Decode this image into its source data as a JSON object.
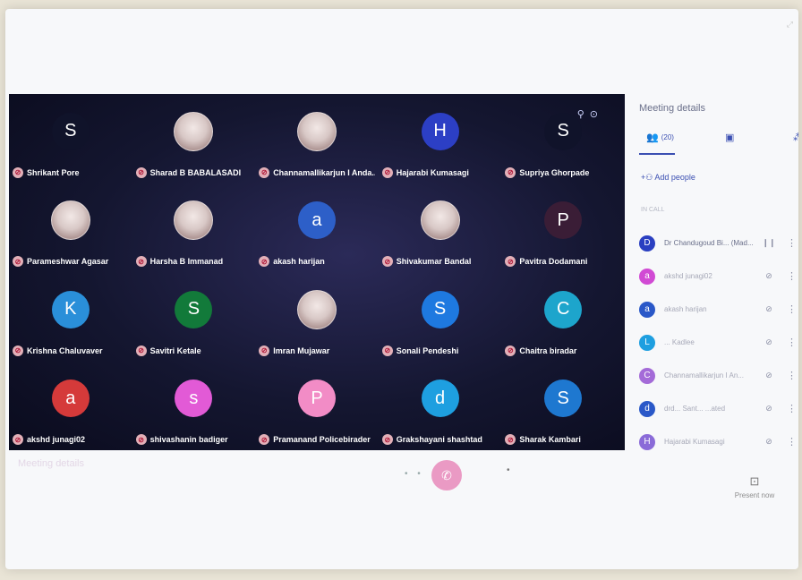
{
  "colors": {
    "grid_bg": "#141630",
    "accent": "#3b4fb2",
    "end_call": "#ea9ac4",
    "mic_muted": "#b01737"
  },
  "tiles": [
    {
      "name": "Shrikant Pore",
      "initial": "S",
      "color": "#10132a",
      "photo": false,
      "tools": false
    },
    {
      "name": "Sharad B BABALASADI",
      "initial": "",
      "color": "",
      "photo": true,
      "tools": false
    },
    {
      "name": "Channamallikarjun I Anda...",
      "initial": "",
      "color": "",
      "photo": true,
      "tools": false
    },
    {
      "name": "Hajarabi Kumasagi",
      "initial": "H",
      "color": "#2c3fc5",
      "photo": false,
      "tools": false
    },
    {
      "name": "Supriya Ghorpade",
      "initial": "S",
      "color": "#10132a",
      "photo": false,
      "tools": true
    },
    {
      "name": "Parameshwar Agasar",
      "initial": "",
      "color": "",
      "photo": true,
      "tools": false
    },
    {
      "name": "Harsha B Immanad",
      "initial": "",
      "color": "",
      "photo": true,
      "tools": false
    },
    {
      "name": "akash harijan",
      "initial": "a",
      "color": "#2d5fc8",
      "photo": false,
      "tools": false
    },
    {
      "name": "Shivakumar Bandal",
      "initial": "",
      "color": "",
      "photo": true,
      "tools": false
    },
    {
      "name": "Pavitra Dodamani",
      "initial": "P",
      "color": "#3a1d36",
      "photo": false,
      "tools": false
    },
    {
      "name": "Krishna Chaluvaver",
      "initial": "K",
      "color": "#2a8fd9",
      "photo": false,
      "tools": false
    },
    {
      "name": "Savitri Ketale",
      "initial": "S",
      "color": "#127a3a",
      "photo": false,
      "tools": false
    },
    {
      "name": "Imran Mujawar",
      "initial": "",
      "color": "",
      "photo": true,
      "tools": false
    },
    {
      "name": "Sonali Pendeshi",
      "initial": "S",
      "color": "#1e79e0",
      "photo": false,
      "tools": false
    },
    {
      "name": "Chaitra biradar",
      "initial": "C",
      "color": "#1da5cc",
      "photo": false,
      "tools": false
    },
    {
      "name": "akshd junagi02",
      "initial": "a",
      "color": "#d53a3a",
      "photo": false,
      "tools": false
    },
    {
      "name": "shivashanin badiger",
      "initial": "s",
      "color": "#e25ad6",
      "photo": false,
      "tools": false
    },
    {
      "name": "Pramanand Policebirader",
      "initial": "P",
      "color": "#f28cc6",
      "photo": false,
      "tools": false
    },
    {
      "name": "Grakshayani shashtad",
      "initial": "d",
      "color": "#1e9fe0",
      "photo": false,
      "tools": false
    },
    {
      "name": "Sharak Kambari",
      "initial": "S",
      "color": "#1e78d0",
      "photo": false,
      "tools": false
    }
  ],
  "bottom": {
    "meeting_title": "Meeting details",
    "present_label": "Present now"
  },
  "panel": {
    "title": "Meeting details",
    "people_count": "(20)",
    "add_people": "Add people",
    "section_label": "In call",
    "people": [
      {
        "initial": "D",
        "color": "#2a3fc1",
        "name": "Dr Chandugoud Bi... (Mad...",
        "first": true
      },
      {
        "initial": "a",
        "color": "#d14ad4",
        "name": "akshd junagi02",
        "first": false
      },
      {
        "initial": "a",
        "color": "#2a58c8",
        "name": "akash harijan",
        "first": false
      },
      {
        "initial": "L",
        "color": "#1e9fe0",
        "name": "... Kadlee",
        "first": false
      },
      {
        "initial": "C",
        "color": "#a46bd8",
        "name": "Channamallikarjun I An...",
        "first": false
      },
      {
        "initial": "d",
        "color": "#2a58c8",
        "name": "drd... Sant... ...ated",
        "first": false
      },
      {
        "initial": "H",
        "color": "#8a6bd8",
        "name": "Hajarabi Kumasagi",
        "first": false
      }
    ]
  }
}
